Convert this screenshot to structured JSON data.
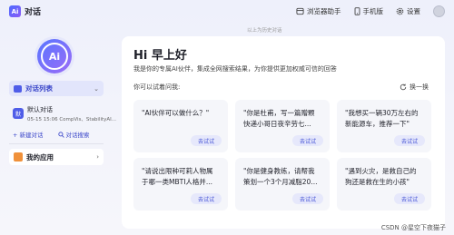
{
  "app": {
    "logo_text": "Ai",
    "title": "对话"
  },
  "topbar": {
    "actions": [
      {
        "label": "浏览器助手",
        "icon": "browser-assistant-icon"
      },
      {
        "label": "手机版",
        "icon": "mobile-icon"
      },
      {
        "label": "设置",
        "icon": "gear-icon"
      }
    ]
  },
  "sidebar": {
    "logo_text": "Ai",
    "chat_list_label": "对话列表",
    "conversation": {
      "icon_text": "默",
      "title": "默认对话",
      "meta": "05-15 15:06  CompVis、StabilityAI..."
    },
    "new_chat_label": "+ 新建对话",
    "search_label": "对话搜索",
    "apps_label": "我的应用"
  },
  "main": {
    "notice": "以上为历史对话",
    "greeting": "Hi 早上好",
    "intro": "我是你的专属AI伙伴，集成全网搜索结果，为你提供更加权威可信的回答",
    "ask_label": "你可以试着问我:",
    "refresh_label": "换一换",
    "try_label": "去试试",
    "cards": [
      {
        "line1": "\"AI伙伴可以做什么？\"",
        "line2": ""
      },
      {
        "line1": "\"你是杜甫，写一篇赠颗",
        "line2": "快递小哥日夜辛劳七..."
      },
      {
        "line1": "\"我想买一辆30万左右的",
        "line2": "新能源车，推荐一下\""
      },
      {
        "line1": "\"请说出限种可莉人物属",
        "line2": "于哪一类MBTI人格并..."
      },
      {
        "line1": "\"你是健身教练，请帮我",
        "line2": "策划一个3个月减脂20..."
      },
      {
        "line1": "\"遇到火灾，是救自己的",
        "line2": "狗还是救在生的小孩\""
      }
    ]
  },
  "watermark": "CSDN @星空下夜猫子"
}
